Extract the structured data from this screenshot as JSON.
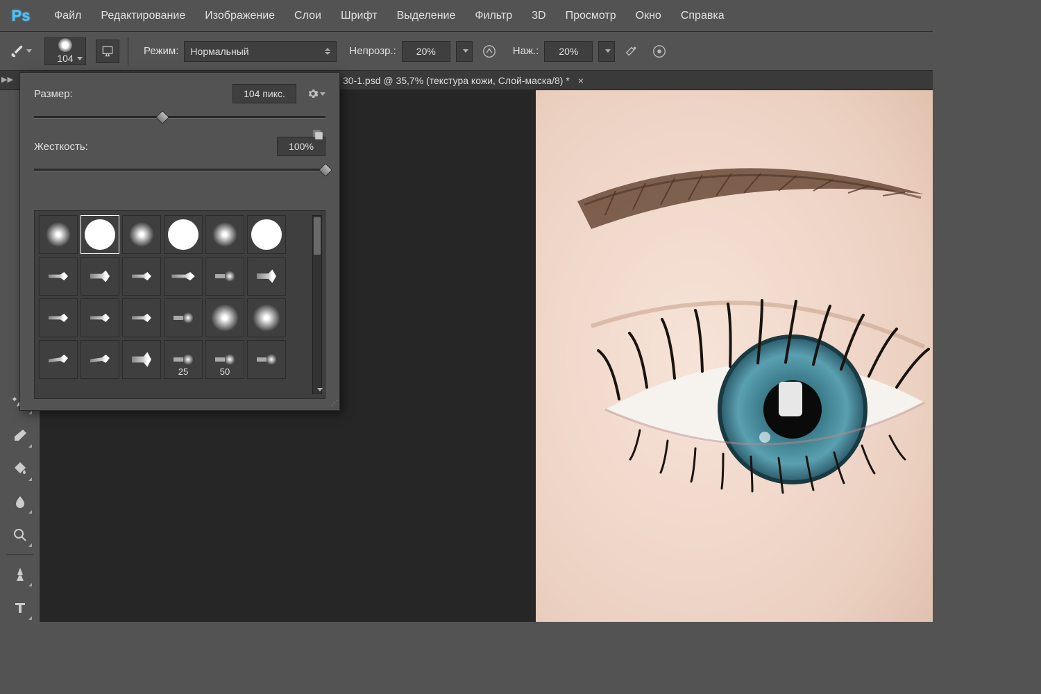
{
  "logo": "Ps",
  "menu": [
    "Файл",
    "Редактирование",
    "Изображение",
    "Слои",
    "Шрифт",
    "Выделение",
    "Фильтр",
    "3D",
    "Просмотр",
    "Окно",
    "Справка"
  ],
  "options": {
    "brush_size_display": "104",
    "mode_label": "Режим:",
    "mode_value": "Нормальный",
    "opacity_label": "Непрозр.:",
    "opacity_value": "20%",
    "flow_label": "Наж.:",
    "flow_value": "20%"
  },
  "tab": {
    "title": "30-1.psd @ 35,7% (текстура кожи, Слой-маска/8) *"
  },
  "brush_popup": {
    "size_label": "Размер:",
    "size_value": "104 пикс.",
    "size_percent": 44,
    "hardness_label": "Жесткость:",
    "hardness_value": "100%",
    "hardness_percent": 100,
    "preset_labels": {
      "cell_25": "25",
      "cell_50": "50"
    }
  },
  "tools": [
    "history-brush",
    "eraser",
    "bucket",
    "blur",
    "dodge",
    "pen",
    "type"
  ]
}
